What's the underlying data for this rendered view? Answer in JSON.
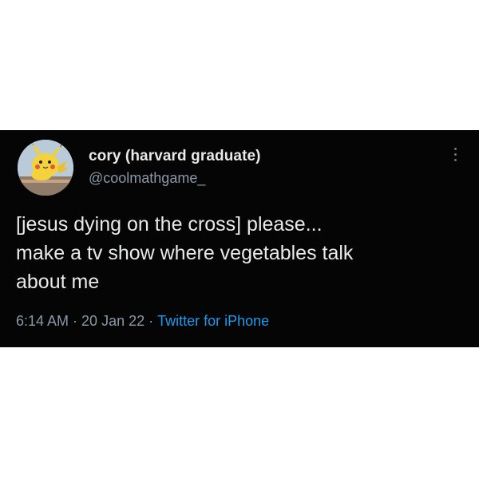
{
  "tweet": {
    "display_name": "cory (harvard graduate)",
    "handle": "@coolmathgame_",
    "text_lines": [
      "[jesus dying on the cross] please...",
      "make a tv show where vegetables talk",
      "about me"
    ],
    "time": "6:14 AM",
    "separator": "·",
    "date": "20 Jan 22",
    "source": "Twitter for iPhone"
  },
  "icons": {
    "avatar": "pikachu-avatar-icon",
    "more": "more-options-icon"
  },
  "colors": {
    "background": "#050505",
    "text": "#e7e9ea",
    "secondary": "#8b98a5",
    "link": "#1d9bf0"
  }
}
